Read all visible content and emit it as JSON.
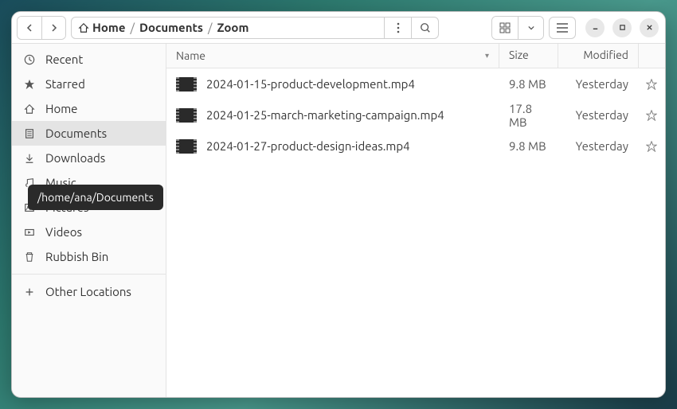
{
  "breadcrumb": {
    "home": "Home",
    "documents": "Documents",
    "current": "Zoom"
  },
  "sidebar": {
    "items": [
      {
        "label": "Recent"
      },
      {
        "label": "Starred"
      },
      {
        "label": "Home"
      },
      {
        "label": "Documents"
      },
      {
        "label": "Downloads"
      },
      {
        "label": "Music"
      },
      {
        "label": "Pictures"
      },
      {
        "label": "Videos"
      },
      {
        "label": "Rubbish Bin"
      }
    ],
    "other": "Other Locations"
  },
  "tooltip": "/home/ana/Documents",
  "columns": {
    "name": "Name",
    "size": "Size",
    "modified": "Modified"
  },
  "files": [
    {
      "name": "2024-01-15-product-development.mp4",
      "size": "9.8 MB",
      "modified": "Yesterday"
    },
    {
      "name": "2024-01-25-march-marketing-campaign.mp4",
      "size": "17.8 MB",
      "modified": "Yesterday"
    },
    {
      "name": "2024-01-27-product-design-ideas.mp4",
      "size": "9.8 MB",
      "modified": "Yesterday"
    }
  ]
}
